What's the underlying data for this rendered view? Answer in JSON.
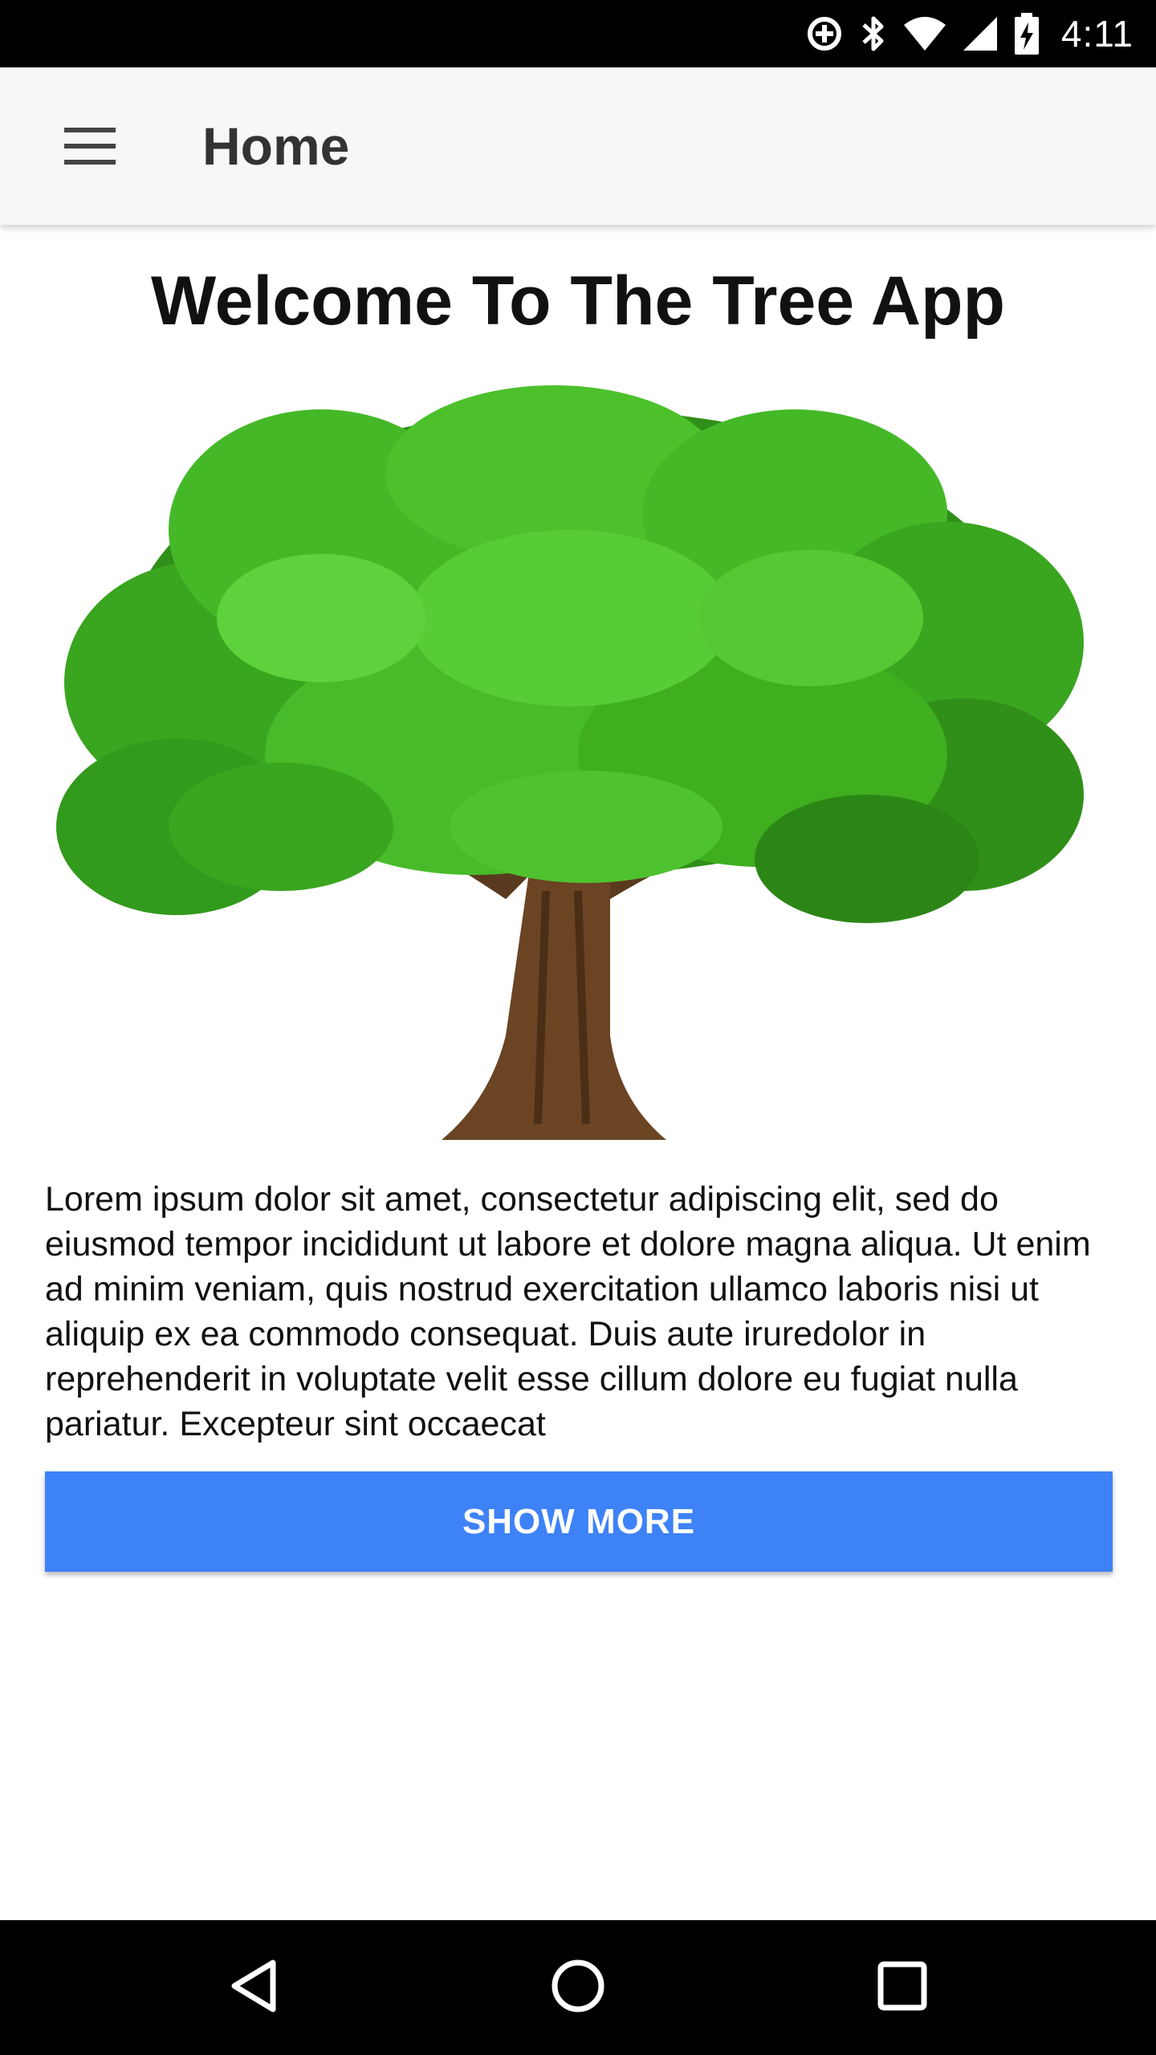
{
  "status_bar": {
    "time": "4:11",
    "icons": [
      "data-saver-icon",
      "bluetooth-icon",
      "wifi-icon",
      "cell-signal-icon",
      "battery-charging-icon"
    ]
  },
  "app_bar": {
    "title": "Home",
    "menu_icon": "hamburger-menu-icon"
  },
  "main": {
    "heading": "Welcome To The Tree App",
    "image": "tree-illustration",
    "body_text": "Lorem ipsum dolor sit amet, consectetur adipiscing elit, sed do eiusmod tempor incididunt ut labore et dolore magna aliqua. Ut enim ad minim veniam, quis nostrud exercitation ullamco laboris nisi ut aliquip ex ea commodo consequat. Duis aute iruredolor in reprehenderit in voluptate velit esse cillum dolore eu fugiat nulla pariatur. Excepteur sint occaecat",
    "show_more_label": "SHOW MORE"
  },
  "nav_bar": {
    "icons": [
      "back-icon",
      "home-icon",
      "recents-icon"
    ]
  },
  "colors": {
    "accent": "#3e82f7",
    "app_bar_bg": "#f7f7f7",
    "leaf_green": "#3fae1f",
    "trunk_brown": "#6b4423"
  }
}
